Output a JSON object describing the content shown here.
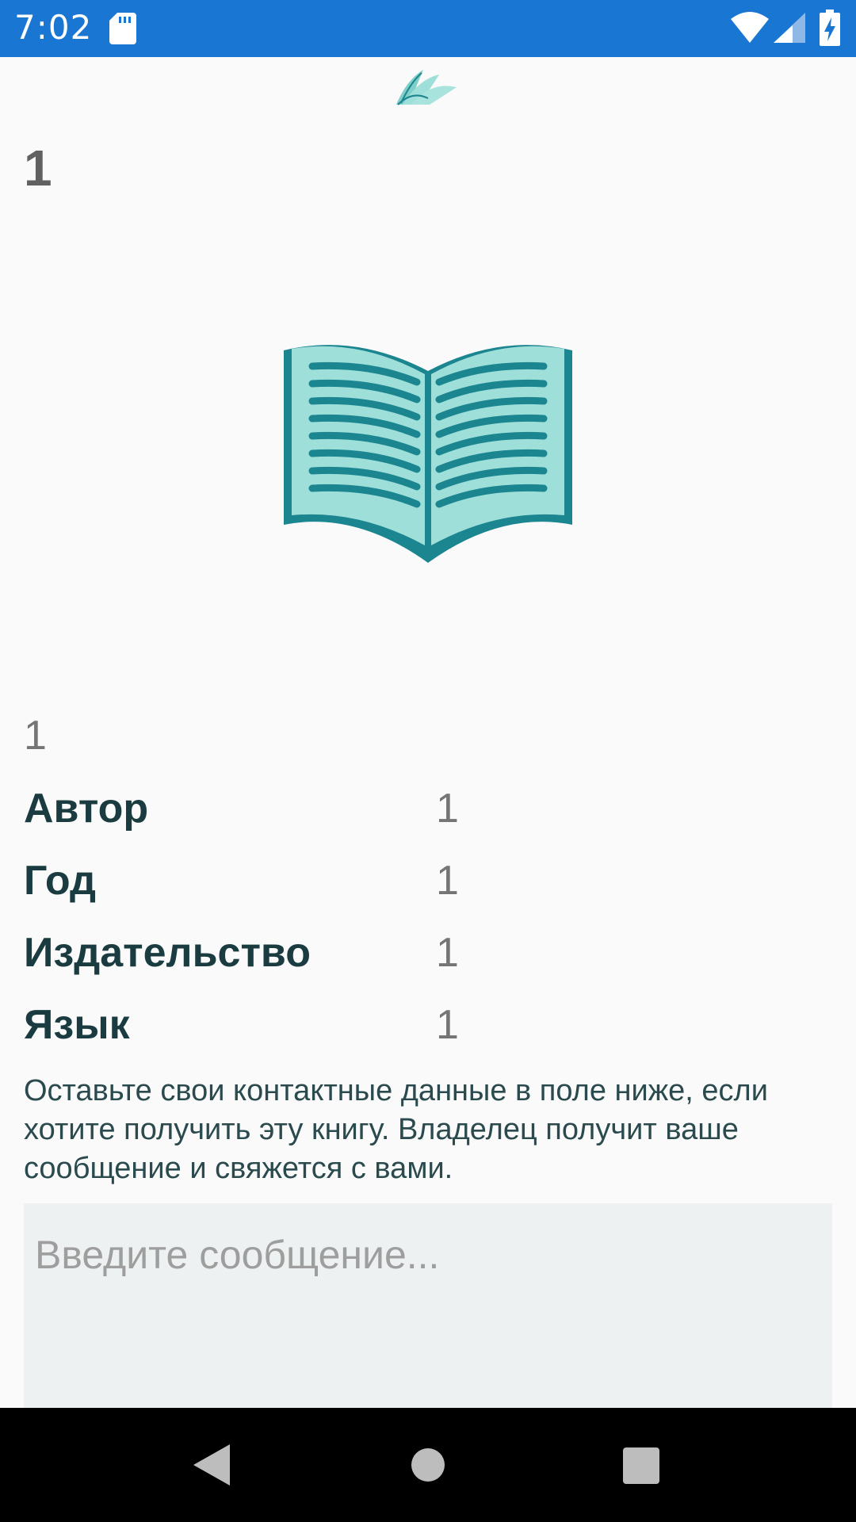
{
  "status_bar": {
    "time": "7:02"
  },
  "book": {
    "title": "1",
    "subtitle": "1",
    "details": [
      {
        "label": "Автор",
        "value": "1"
      },
      {
        "label": "Год",
        "value": "1"
      },
      {
        "label": "Издательство",
        "value": "1"
      },
      {
        "label": "Язык",
        "value": "1"
      }
    ]
  },
  "info_text": "Оставьте свои контактные данные в поле ниже, если хотите получить эту книгу. Владелец получит ваше сообщение и свяжется с вами.",
  "message": {
    "placeholder": "Введите сообщение...",
    "value": ""
  },
  "colors": {
    "status_bar": "#1976d2",
    "accent": "#9fdfd9",
    "accent_dark": "#1b8590",
    "label": "#1a3c40",
    "field_bg": "#edf1f1"
  },
  "icons": [
    "sd-card-icon",
    "wifi-icon",
    "signal-icon",
    "battery-charging-icon",
    "app-logo-icon",
    "open-book-icon",
    "back-icon",
    "home-icon",
    "recent-apps-icon"
  ]
}
